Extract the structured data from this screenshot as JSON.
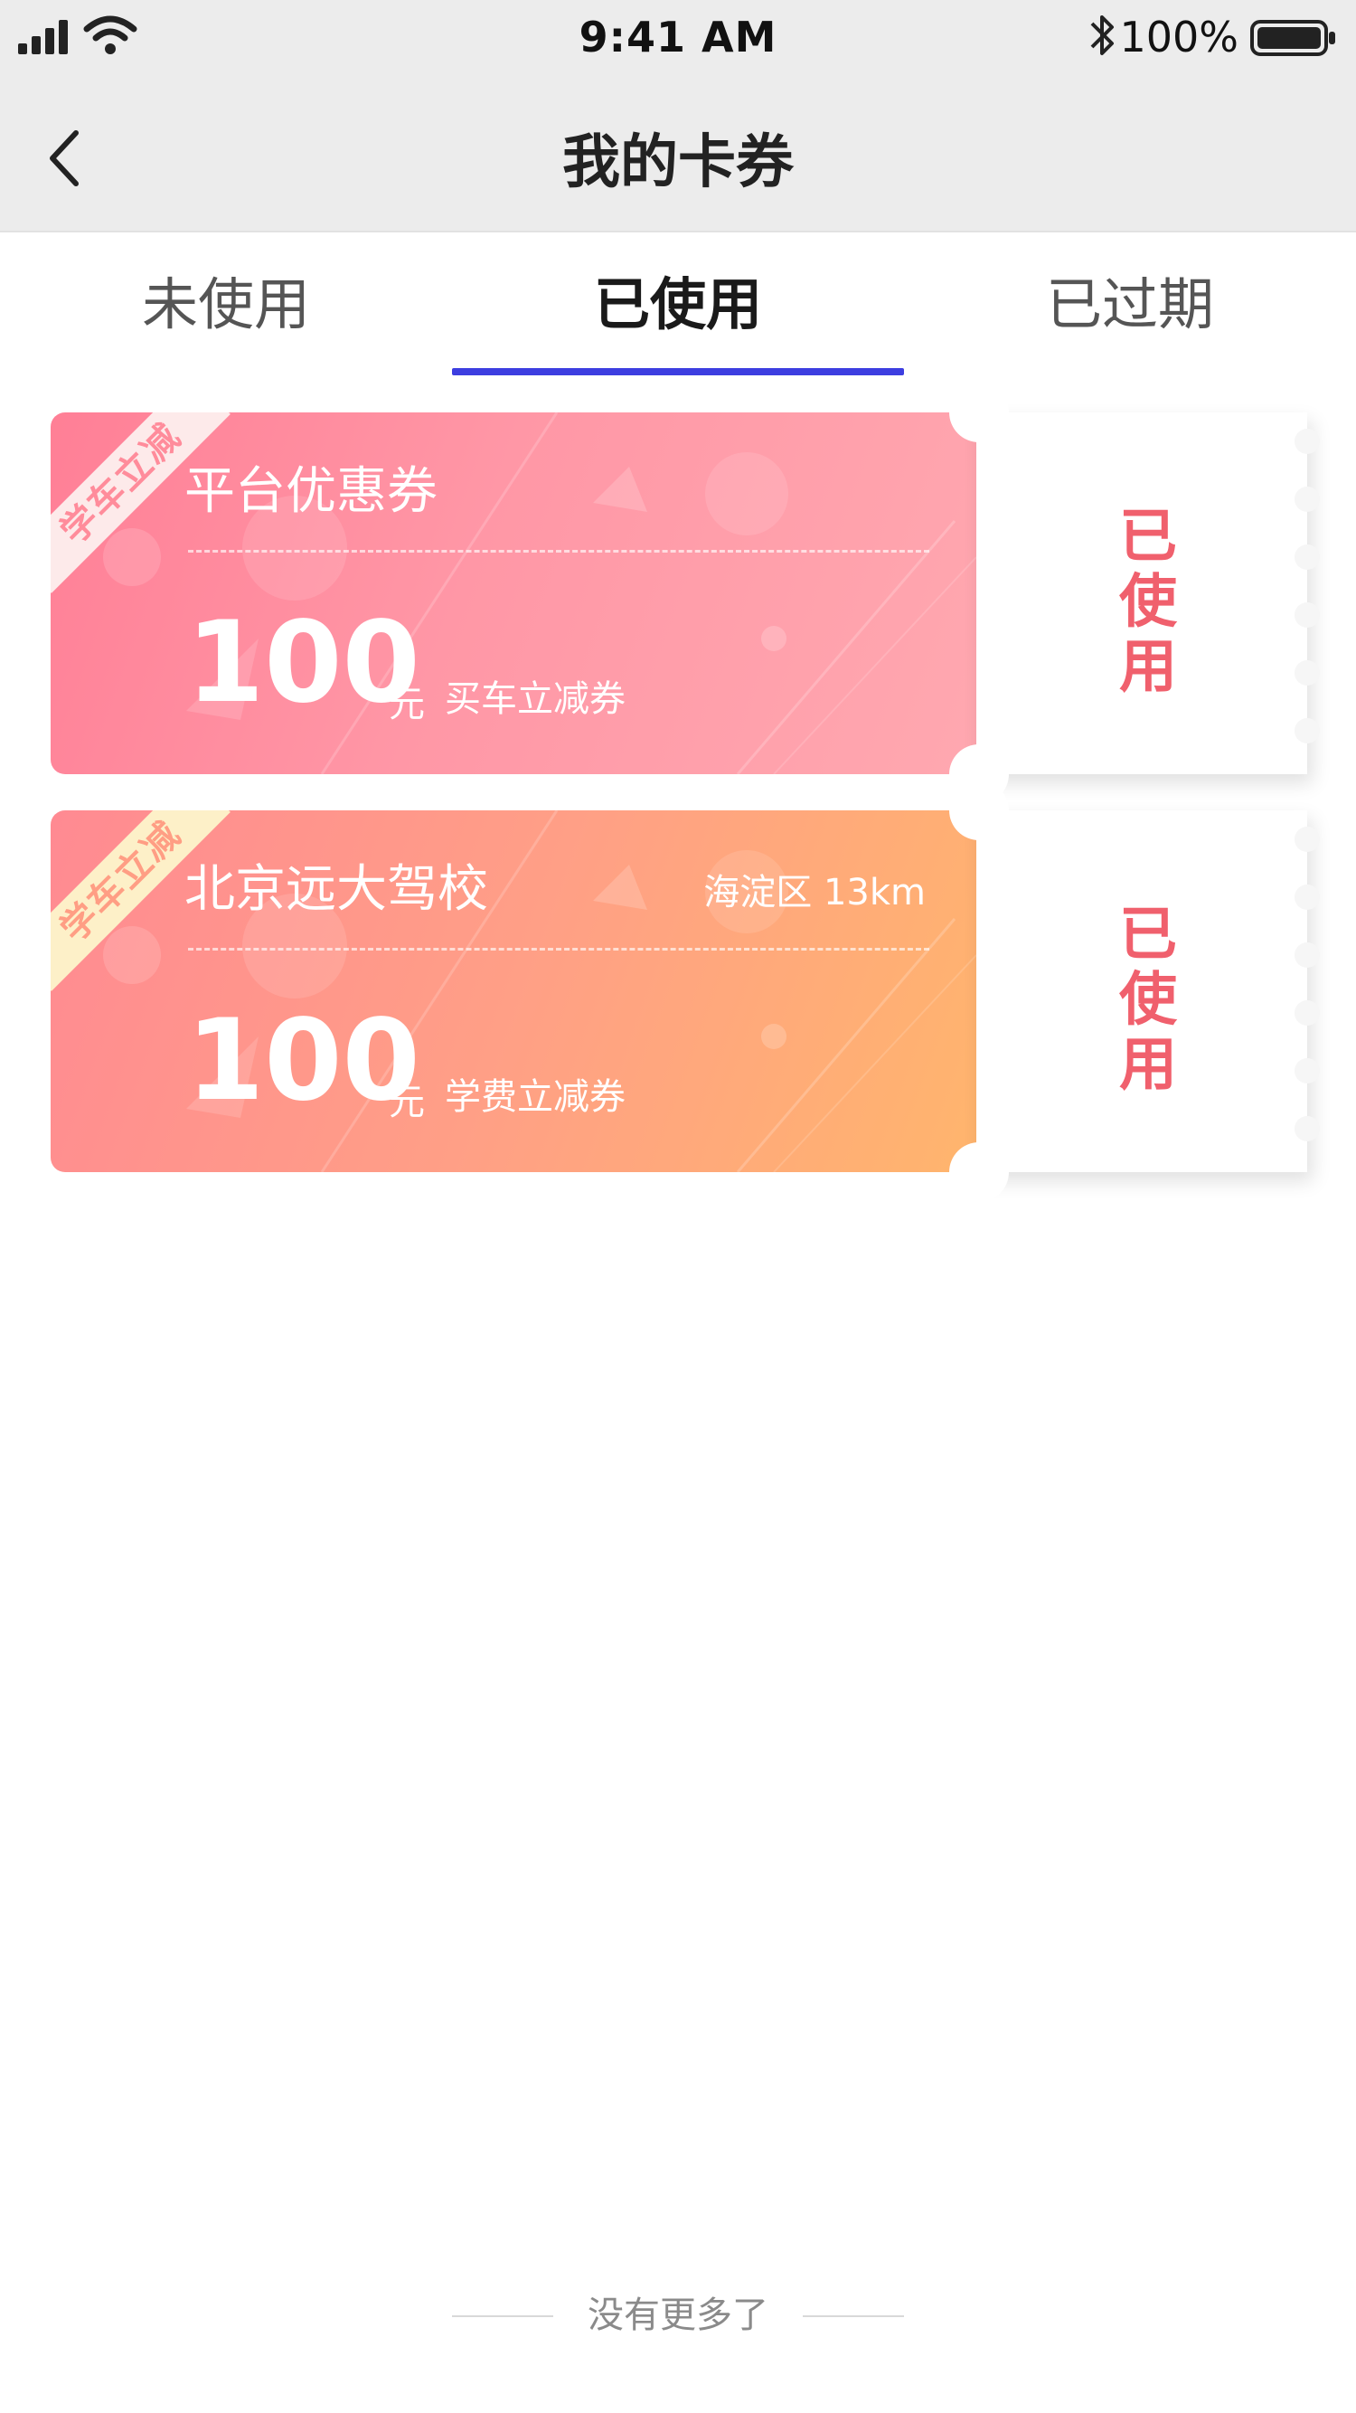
{
  "status_bar": {
    "time": "9:41 AM",
    "battery": "100%"
  },
  "nav": {
    "title": "我的卡券"
  },
  "tabs": [
    {
      "label": "未使用",
      "active": false
    },
    {
      "label": "已使用",
      "active": true
    },
    {
      "label": "已过期",
      "active": false
    }
  ],
  "coupons": [
    {
      "ribbon": "学车立减",
      "name": "平台优惠券",
      "location": "",
      "amount": "100",
      "unit": "元",
      "desc": "买车立减券",
      "status": "已使用",
      "theme": "pink"
    },
    {
      "ribbon": "学车立减",
      "name": "北京远大驾校",
      "location": "海淀区  13km",
      "amount": "100",
      "unit": "元",
      "desc": "学费立减券",
      "status": "已使用",
      "theme": "orange"
    }
  ],
  "footer": {
    "text": "没有更多了"
  },
  "colors": {
    "tab_indicator": "#3d3ee0",
    "status_text": "#f0606d"
  }
}
